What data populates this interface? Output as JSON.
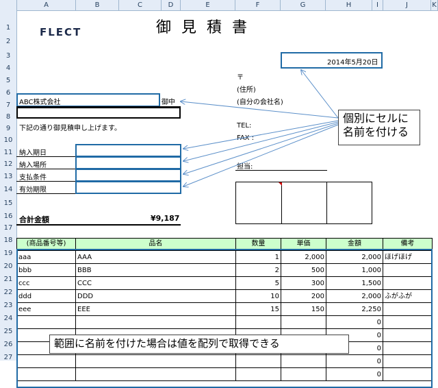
{
  "columns": [
    "A",
    "B",
    "C",
    "D",
    "E",
    "F",
    "G",
    "H",
    "I",
    "J",
    "K"
  ],
  "rows": [
    "1",
    "2",
    "3",
    "4",
    "5",
    "6",
    "7",
    "8",
    "9",
    "10",
    "11",
    "12",
    "13",
    "14",
    "15",
    "16",
    "17",
    "18",
    "19",
    "20",
    "21",
    "22",
    "23",
    "24",
    "25",
    "26",
    "27"
  ],
  "logo": "FLECT",
  "title": "御 見 積 書",
  "date": "2014年5月20日",
  "customer": {
    "name": "ABC株式会社",
    "suffix": "御中"
  },
  "intro": "下記の通り御見積申し上げます。",
  "sender": {
    "postal": "〒",
    "address": "(住所)",
    "company": "(自分の会社名)",
    "tel": "TEL:",
    "fax": "FAX :",
    "person": "担当:"
  },
  "fields": [
    "納入期日",
    "納入場所",
    "支払条件",
    "有効期限"
  ],
  "total": {
    "label": "合計金額",
    "value": "¥9,187"
  },
  "table": {
    "headers": [
      "(商品番号等)",
      "品名",
      "数量",
      "単価",
      "金額",
      "備考"
    ],
    "rows": [
      {
        "code": "aaa",
        "name": "AAA",
        "qty": "1",
        "price": "2,000",
        "amount": "2,000",
        "note": "ほげほげ"
      },
      {
        "code": "bbb",
        "name": "BBB",
        "qty": "2",
        "price": "500",
        "amount": "1,000",
        "note": ""
      },
      {
        "code": "ccc",
        "name": "CCC",
        "qty": "5",
        "price": "300",
        "amount": "1,500",
        "note": ""
      },
      {
        "code": "ddd",
        "name": "DDD",
        "qty": "10",
        "price": "200",
        "amount": "2,000",
        "note": "ふがふが"
      },
      {
        "code": "eee",
        "name": "EEE",
        "qty": "15",
        "price": "150",
        "amount": "2,250",
        "note": ""
      },
      {
        "code": "",
        "name": "",
        "qty": "",
        "price": "",
        "amount": "0",
        "note": ""
      },
      {
        "code": "",
        "name": "",
        "qty": "",
        "price": "",
        "amount": "0",
        "note": ""
      },
      {
        "code": "",
        "name": "",
        "qty": "",
        "price": "",
        "amount": "0",
        "note": ""
      },
      {
        "code": "",
        "name": "",
        "qty": "",
        "price": "",
        "amount": "0",
        "note": ""
      },
      {
        "code": "",
        "name": "",
        "qty": "",
        "price": "",
        "amount": "0",
        "note": ""
      }
    ]
  },
  "callouts": {
    "cell_names": "個別にセルに\n名前を付ける",
    "range_names": "範囲に名前を付けた場合は値を配列で取得できる"
  },
  "colors": {
    "accent": "#1f6aa5",
    "header_green": "#ccffcc",
    "header_bg": "#e4ecf7"
  }
}
